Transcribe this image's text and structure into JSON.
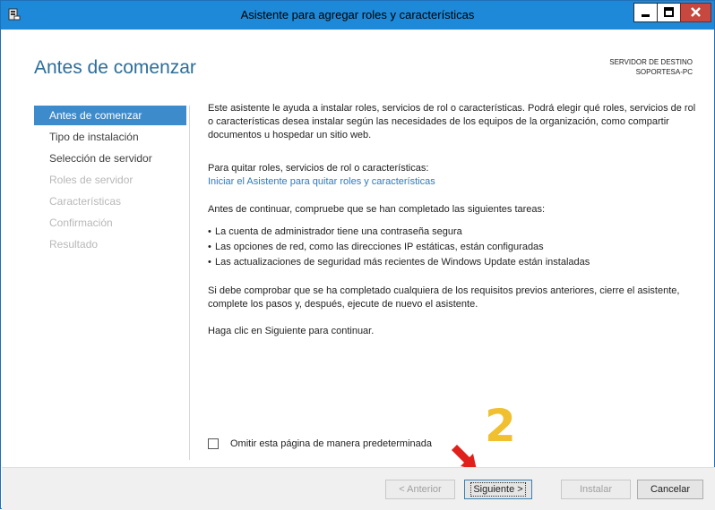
{
  "window": {
    "title": "Asistente para agregar roles y características",
    "controls": {
      "minimize": "_",
      "maximize": "□",
      "close": "x"
    }
  },
  "header": {
    "page_title": "Antes de comenzar",
    "destination_label": "SERVIDOR DE DESTINO",
    "destination_server": "SOPORTESA-PC"
  },
  "nav": {
    "items": [
      {
        "label": "Antes de comenzar",
        "state": "active"
      },
      {
        "label": "Tipo de instalación",
        "state": "enabled"
      },
      {
        "label": "Selección de servidor",
        "state": "enabled"
      },
      {
        "label": "Roles de servidor",
        "state": "disabled"
      },
      {
        "label": "Características",
        "state": "disabled"
      },
      {
        "label": "Confirmación",
        "state": "disabled"
      },
      {
        "label": "Resultado",
        "state": "disabled"
      }
    ]
  },
  "content": {
    "intro": "Este asistente le ayuda a instalar roles, servicios de rol o características. Podrá elegir qué roles, servicios de rol o características desea instalar según las necesidades de los equipos de la organización, como compartir documentos u hospedar un sitio web.",
    "remove_heading": "Para quitar roles, servicios de rol o características:",
    "remove_link": "Iniciar el Asistente para quitar roles y características",
    "tasks_heading": "Antes de continuar, compruebe que se han completado las siguientes tareas:",
    "tasks": [
      "La cuenta de administrador tiene una contraseña segura",
      "Las opciones de red, como las direcciones IP estáticas, están configuradas",
      "Las actualizaciones de seguridad más recientes de Windows Update están instaladas"
    ],
    "prereq_note": "Si debe comprobar que se ha completado cualquiera de los requisitos previos anteriores, cierre el asistente, complete los pasos y, después, ejecute de nuevo el asistente.",
    "continue_note": "Haga clic en Siguiente para continuar.",
    "bullet": "•"
  },
  "skip_page": {
    "label": "Omitir esta página de manera predeterminada",
    "checked": false
  },
  "buttons": {
    "back": "< Anterior",
    "next": "Siguiente >",
    "install": "Instalar",
    "cancel": "Cancelar"
  },
  "annotation": {
    "step_number": "2",
    "color": "#f0c030",
    "arrow_color": "#e0201a"
  },
  "colors": {
    "titlebar": "#1e89d8",
    "accent": "#3d8bcb",
    "link": "#2c7ac0",
    "heading": "#2d6e99"
  }
}
